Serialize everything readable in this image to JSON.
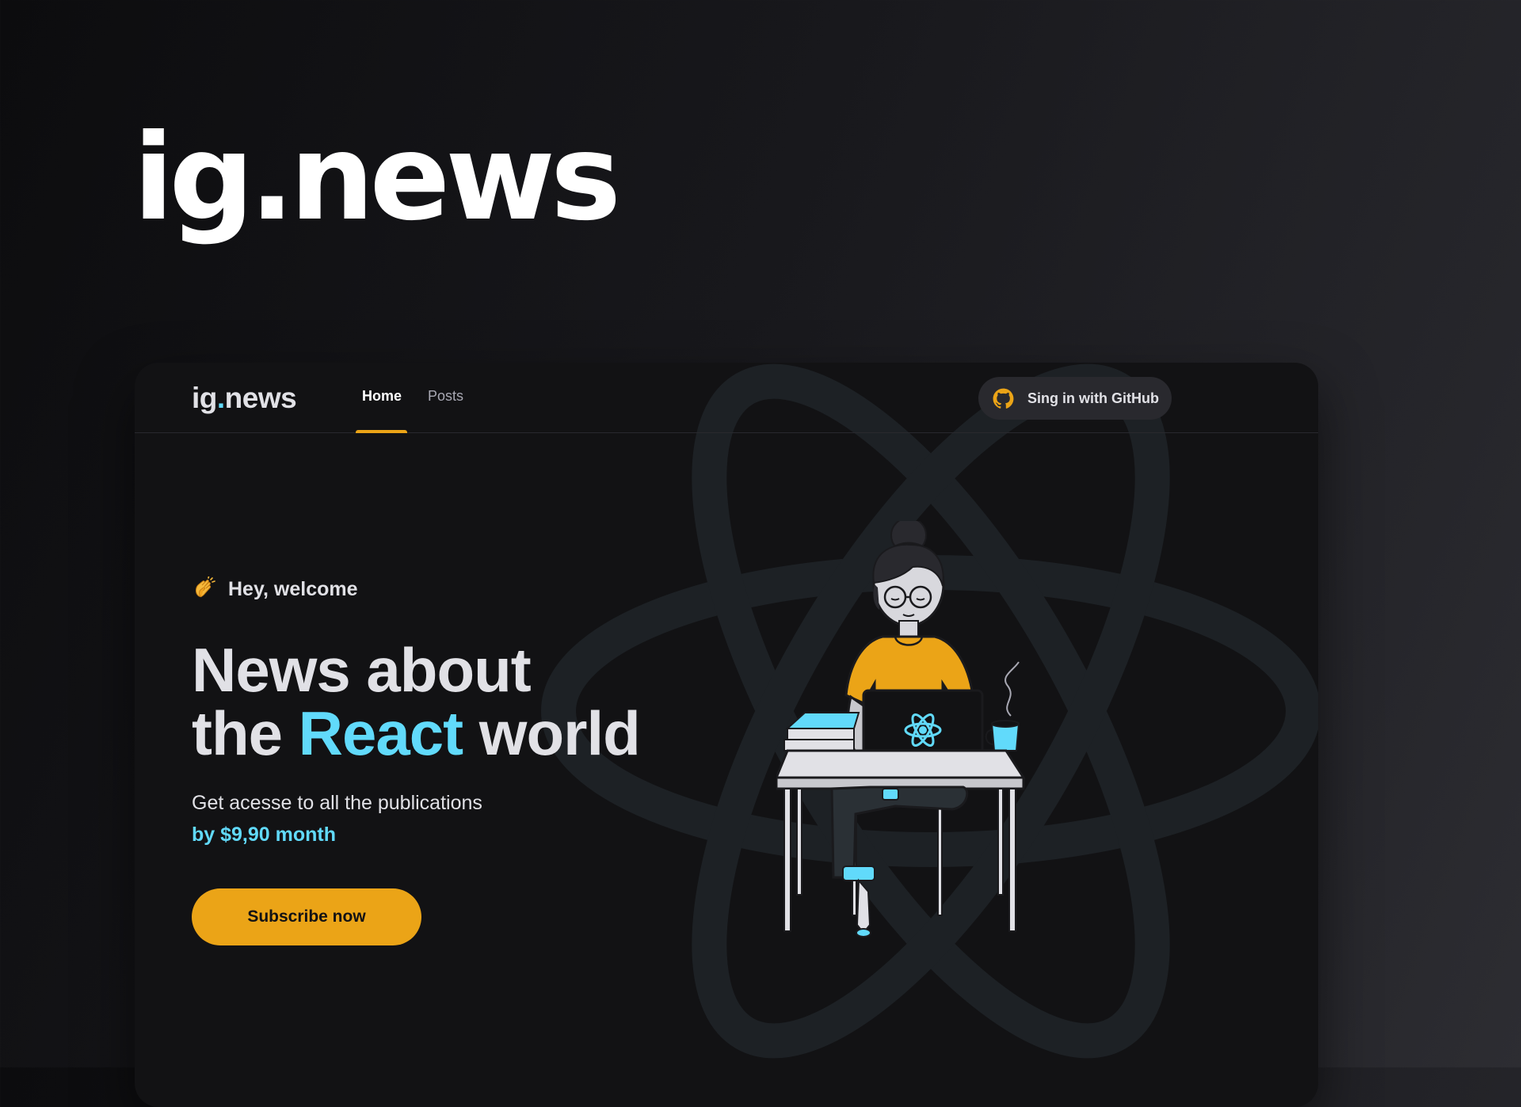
{
  "hero": {
    "title": "ig.news"
  },
  "app": {
    "logo_main": "ig",
    "logo_dot": ".",
    "logo_suffix": "news",
    "nav": [
      {
        "label": "Home",
        "active": true
      },
      {
        "label": "Posts",
        "active": false
      }
    ],
    "signin_label": "Sing in with GitHub",
    "welcome_emoji": "clap-icon",
    "welcome_text": "Hey, welcome",
    "headline_line1": "News about",
    "headline_line2_prefix": "the ",
    "headline_accent": "React",
    "headline_line2_suffix": " world",
    "subtitle": "Get acesse to all the publications",
    "price": "by $9,90 month",
    "subscribe_label": "Subscribe now"
  },
  "colors": {
    "accent_yellow": "#eba417",
    "accent_cyan": "#61dafb",
    "window_bg": "#121214",
    "header_button_bg": "#29292e",
    "text_light": "#e1e1e6",
    "text_muted": "#a8a8b3"
  },
  "icons": [
    "github-icon",
    "clap-icon",
    "react-atom-icon"
  ]
}
